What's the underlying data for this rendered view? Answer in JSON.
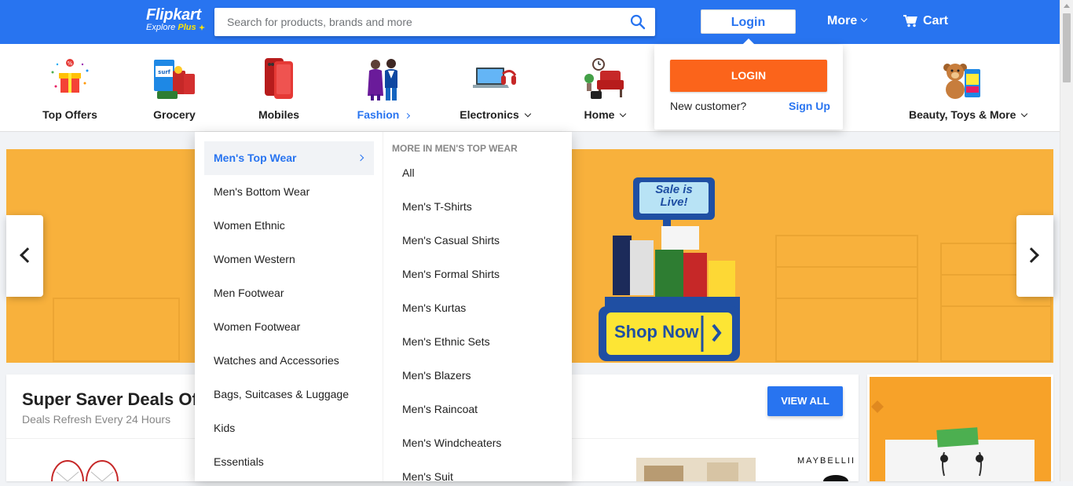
{
  "header": {
    "logo": "Flipkart",
    "logo_sub_prefix": "Explore",
    "logo_sub_plus": "Plus",
    "search_placeholder": "Search for products, brands and more",
    "login_label": "Login",
    "more_label": "More",
    "cart_label": "Cart",
    "brand_color": "#2874f0"
  },
  "categories": [
    {
      "label": "Top Offers",
      "icon": "top-offers-icon",
      "has_dropdown": false
    },
    {
      "label": "Grocery",
      "icon": "grocery-icon",
      "has_dropdown": false
    },
    {
      "label": "Mobiles",
      "icon": "mobiles-icon",
      "has_dropdown": false
    },
    {
      "label": "Fashion",
      "icon": "fashion-icon",
      "has_dropdown": true,
      "active": true
    },
    {
      "label": "Electronics",
      "icon": "electronics-icon",
      "has_dropdown": true
    },
    {
      "label": "Home",
      "icon": "home-icon",
      "has_dropdown": true
    },
    {
      "label": "Beauty, Toys & More",
      "icon": "beauty-toys-icon",
      "has_dropdown": true
    }
  ],
  "fashion_menu": {
    "left_items": [
      "Men's Top Wear",
      "Men's Bottom Wear",
      "Women Ethnic",
      "Women Western",
      "Men Footwear",
      "Women Footwear",
      "Watches and Accessories",
      "Bags, Suitcases & Luggage",
      "Kids",
      "Essentials"
    ],
    "active_index": 0,
    "right_heading": "MORE IN MEN'S TOP WEAR",
    "right_items": [
      "All",
      "Men's T-Shirts",
      "Men's Casual Shirts",
      "Men's Formal Shirts",
      "Men's Kurtas",
      "Men's Ethnic Sets",
      "Men's Blazers",
      "Men's Raincoat",
      "Men's Windcheaters",
      "Men's Suit"
    ]
  },
  "login_popup": {
    "login_button": "LOGIN",
    "new_customer": "New customer?",
    "sign_up": "Sign Up",
    "button_color": "#fb641b"
  },
  "banner": {
    "sign_text_1": "Sale is",
    "sign_text_2": "Live!",
    "cta": "Shop Now",
    "bg_color": "#f8b13c"
  },
  "deals": {
    "title": "Super Saver Deals Of T",
    "subtitle": "Deals Refresh Every 24 Hours",
    "view_all": "VIEW ALL",
    "brand_text": "MAYBELLII"
  }
}
